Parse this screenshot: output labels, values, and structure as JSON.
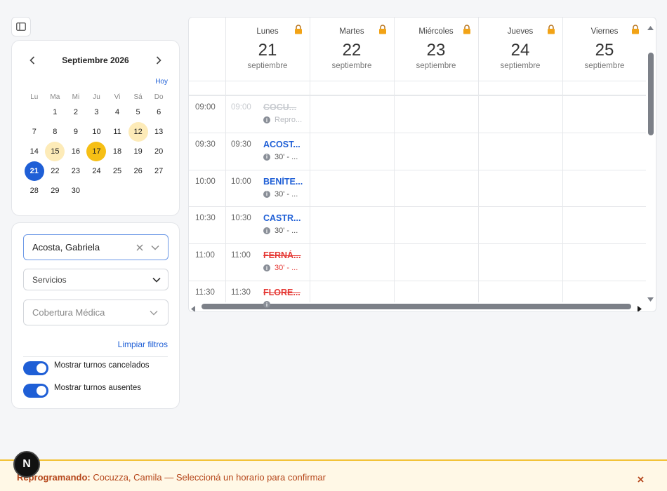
{
  "calendar": {
    "month_title": "Septiembre 2026",
    "today_label": "Hoy",
    "weekdays": [
      "Lu",
      "Ma",
      "Mi",
      "Ju",
      "Vi",
      "Sá",
      "Do"
    ],
    "weeks": [
      [
        "",
        "1",
        "2",
        "3",
        "4",
        "5",
        "6"
      ],
      [
        "7",
        "8",
        "9",
        "10",
        "11",
        "12",
        "13"
      ],
      [
        "14",
        "15",
        "16",
        "17",
        "18",
        "19",
        "20"
      ],
      [
        "21",
        "22",
        "23",
        "24",
        "25",
        "26",
        "27"
      ],
      [
        "28",
        "29",
        "30",
        "",
        "",
        "",
        ""
      ]
    ],
    "highlighted_days": [
      "12",
      "15"
    ],
    "today_day": "17",
    "selected_day": "21",
    "colors": {
      "selected": "#1f5fd6",
      "today": "#f6bf15",
      "highlight": "#fdebb8"
    }
  },
  "filters": {
    "professional_value": "Acosta, Gabriela",
    "services_value": "Servicios",
    "coverage_placeholder": "Cobertura Médica",
    "clear_label": "Limpiar filtros",
    "toggle_cancelled_label": "Mostrar turnos cancelados",
    "toggle_absent_label": "Mostrar turnos ausentes",
    "toggle_cancelled_on": true,
    "toggle_absent_on": true
  },
  "schedule": {
    "days": [
      {
        "name": "Lunes",
        "number": "21",
        "month": "septiembre"
      },
      {
        "name": "Martes",
        "number": "22",
        "month": "septiembre"
      },
      {
        "name": "Miércoles",
        "number": "23",
        "month": "septiembre"
      },
      {
        "name": "Jueves",
        "number": "24",
        "month": "septiembre"
      },
      {
        "name": "Viernes",
        "number": "25",
        "month": "septiembre"
      }
    ],
    "slots": [
      {
        "time": "09:00",
        "slot_time": "09:00",
        "name": "COCU...",
        "detail": "Repro...",
        "status": "rescheduling"
      },
      {
        "time": "09:30",
        "slot_time": "09:30",
        "name": "ACOST...",
        "detail": "30' - ...",
        "status": "normal"
      },
      {
        "time": "10:00",
        "slot_time": "10:00",
        "name": "BENÍTE...",
        "detail": "30' - ...",
        "status": "normal"
      },
      {
        "time": "10:30",
        "slot_time": "10:30",
        "name": "CASTR...",
        "detail": "30' - ...",
        "status": "normal"
      },
      {
        "time": "11:00",
        "slot_time": "11:00",
        "name": "FERNÁ...",
        "detail": "30' - ...",
        "status": "cancelled"
      },
      {
        "time": "11:30",
        "slot_time": "11:30",
        "name": "FLORE...",
        "detail": "",
        "status": "cancelled"
      }
    ]
  },
  "banner": {
    "prefix": "Reprogramando:",
    "message": " Cocuzza, Camila — Seleccioná un horario para confirmar",
    "badge_letter": "N"
  }
}
